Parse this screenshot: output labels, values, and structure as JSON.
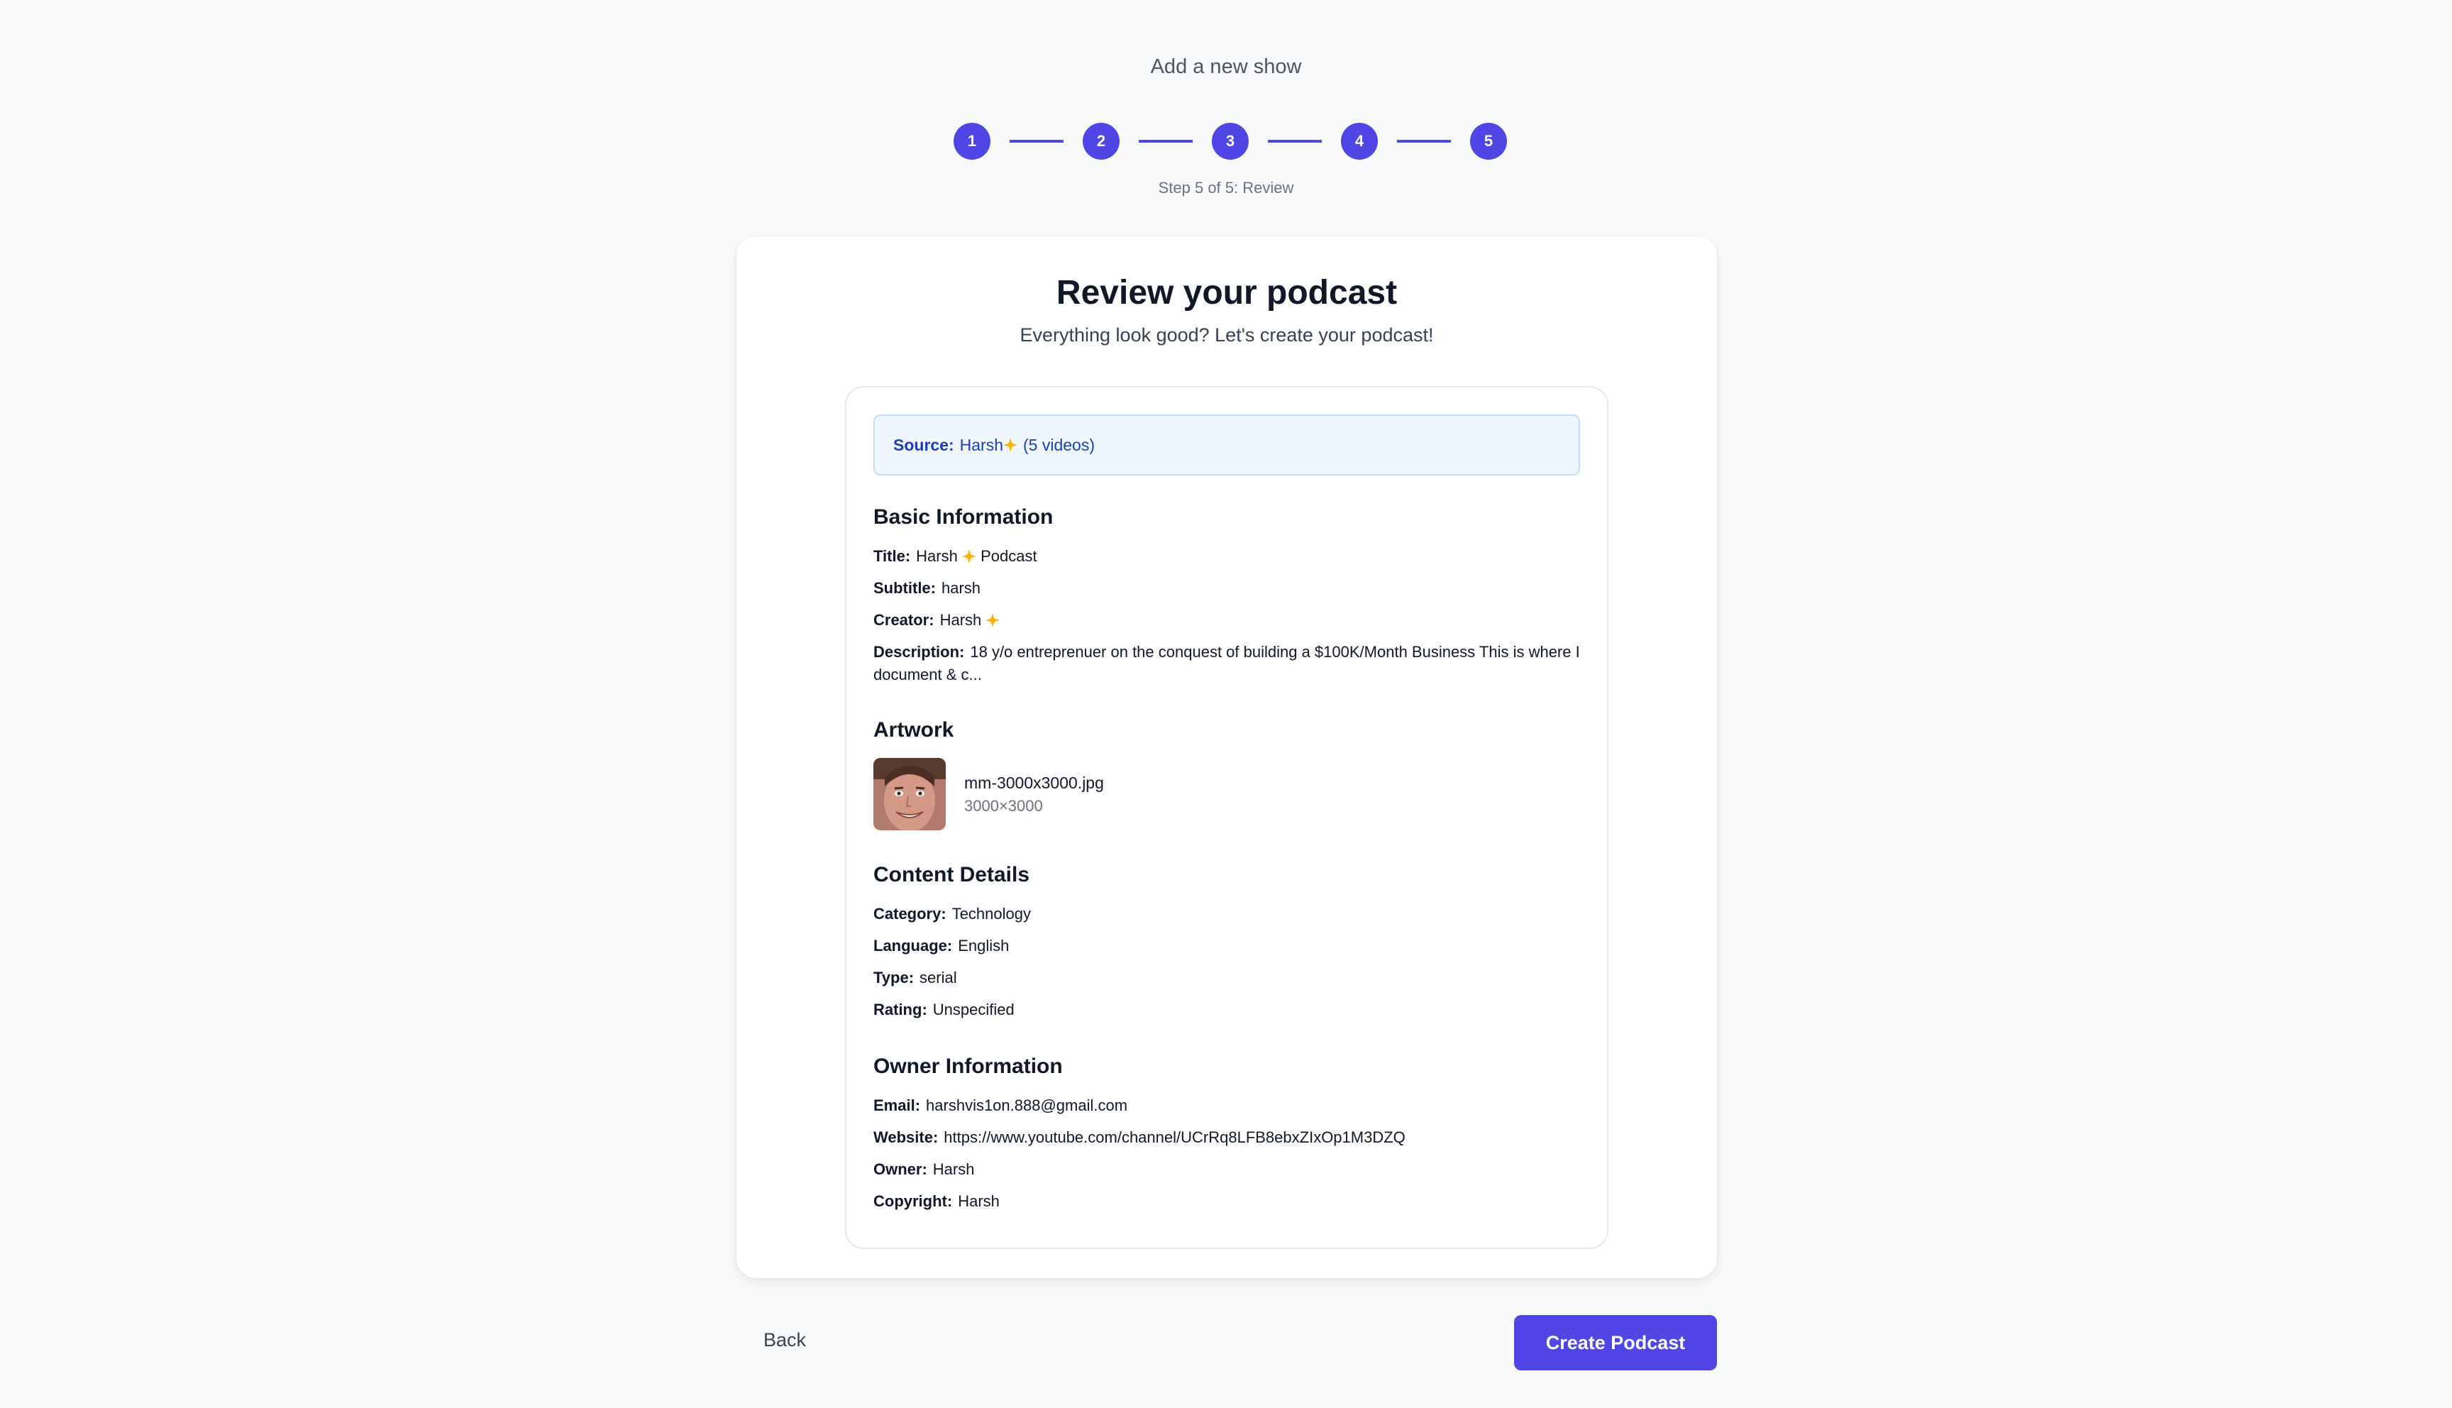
{
  "page": {
    "heading": "Add a new show"
  },
  "stepper": {
    "steps": [
      "1",
      "2",
      "3",
      "4",
      "5"
    ],
    "caption": "Step 5 of 5: Review"
  },
  "card": {
    "title": "Review your podcast",
    "subtitle": "Everything look good? Let's create your podcast!"
  },
  "source": {
    "label": "Source:",
    "name": "Harsh",
    "count": "(5 videos)"
  },
  "basic_info": {
    "heading": "Basic Information",
    "title_label": "Title:",
    "title_name": "Harsh",
    "title_suffix": "Podcast",
    "subtitle_label": "Subtitle:",
    "subtitle_value": "harsh",
    "creator_label": "Creator:",
    "creator_value": "Harsh",
    "description_label": "Description:",
    "description_value": "18 y/o entreprenuer on the conquest of building a $100K/Month Business This is where I document & c..."
  },
  "artwork": {
    "heading": "Artwork",
    "filename": "mm-3000x3000.jpg",
    "dimensions": "3000×3000"
  },
  "content_details": {
    "heading": "Content Details",
    "category_label": "Category:",
    "category_value": "Technology",
    "language_label": "Language:",
    "language_value": "English",
    "type_label": "Type:",
    "type_value": "serial",
    "rating_label": "Rating:",
    "rating_value": "Unspecified"
  },
  "owner_info": {
    "heading": "Owner Information",
    "email_label": "Email:",
    "email_value": "harshvis1on.888@gmail.com",
    "website_label": "Website:",
    "website_value": "https://www.youtube.com/channel/UCrRq8LFB8ebxZIxOp1M3DZQ",
    "owner_label": "Owner:",
    "owner_value": "Harsh",
    "copyright_label": "Copyright:",
    "copyright_value": "Harsh"
  },
  "actions": {
    "back_label": "Back",
    "create_label": "Create Podcast"
  },
  "colors": {
    "accent": "#4f46e5",
    "background": "#f9fafb",
    "banner_bg": "#eff6ff",
    "banner_text": "#1e40af",
    "sparkle": "#f5b301"
  },
  "icons": {
    "name_decoration": "sparkle-icon"
  }
}
